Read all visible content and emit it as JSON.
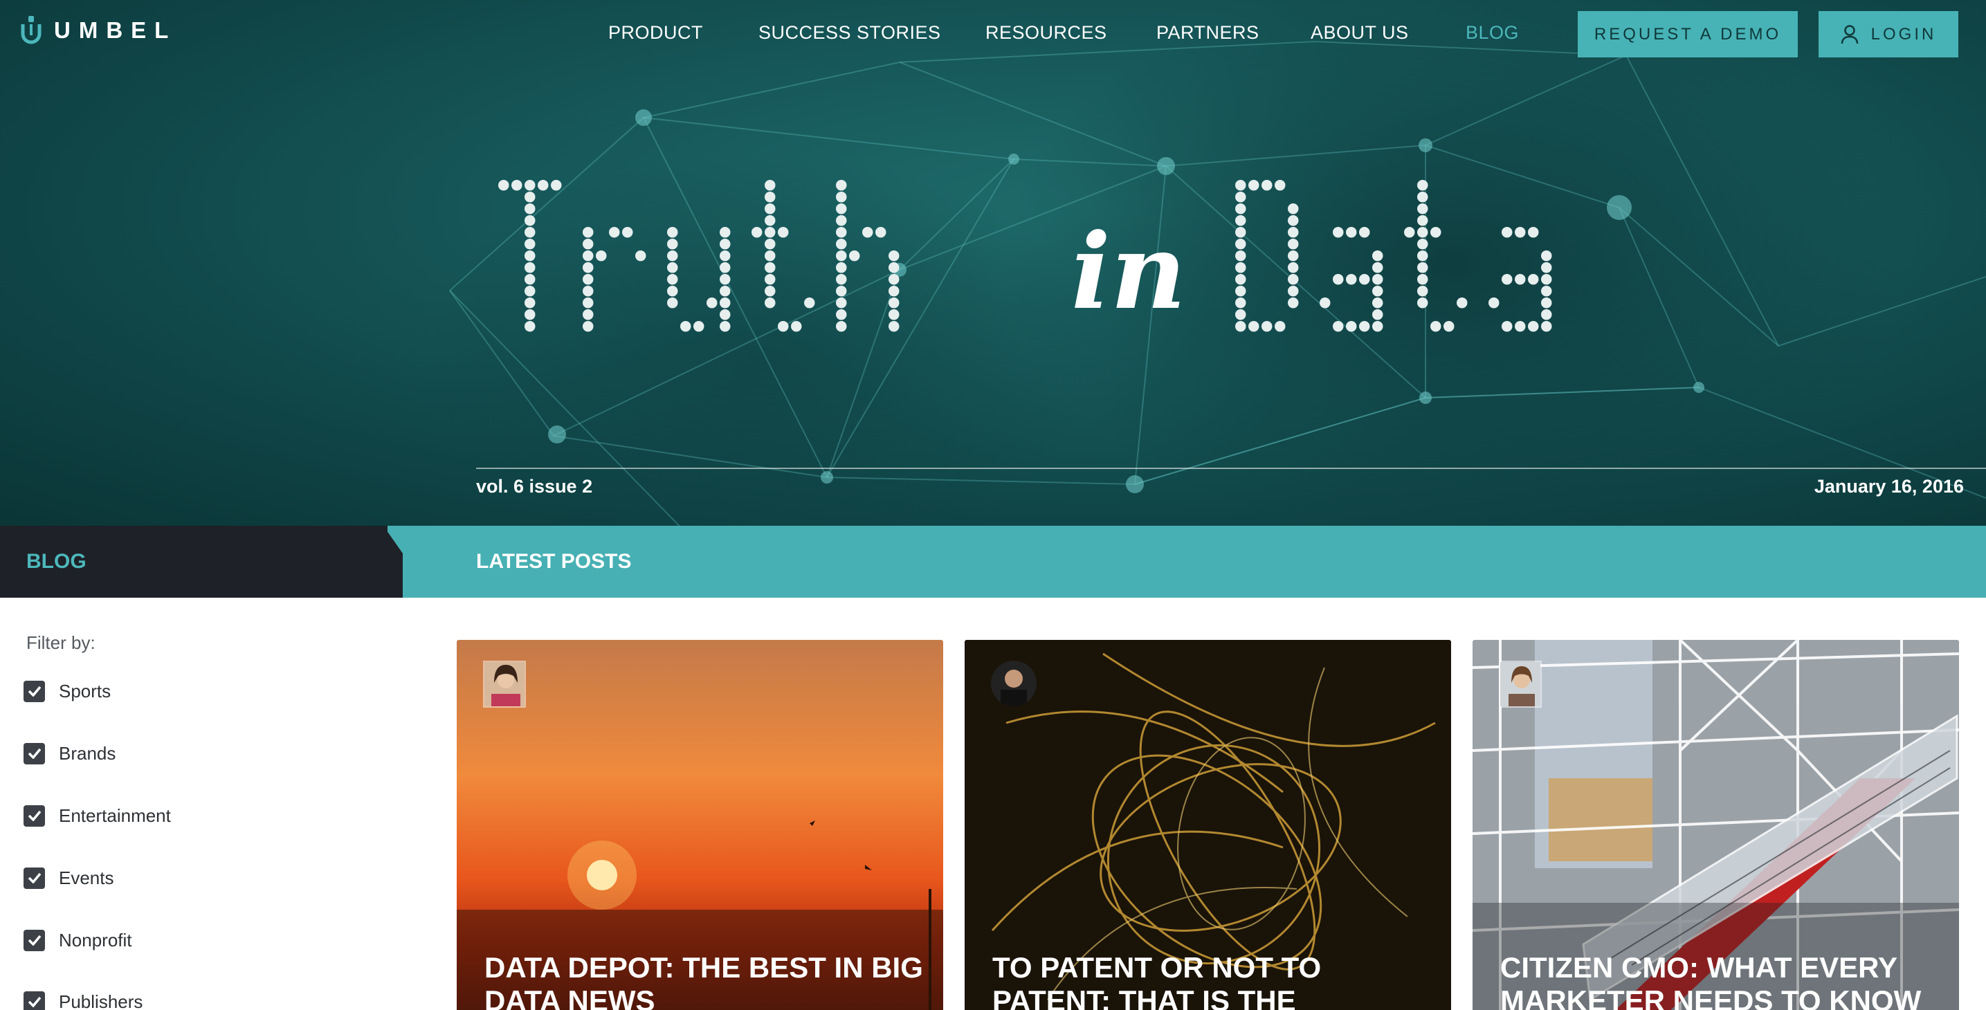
{
  "brand": {
    "name": "UMBEL"
  },
  "nav": {
    "links": [
      "PRODUCT",
      "SUCCESS STORIES",
      "RESOURCES",
      "PARTNERS",
      "ABOUT US",
      "BLOG"
    ],
    "demo_button": "REQUEST A DEMO",
    "login_button": "LOGIN"
  },
  "hero": {
    "title_word1": "Truth",
    "title_word2": "in",
    "title_word3": "Data",
    "issue": "vol. 6 issue 2",
    "date": "January 16, 2016"
  },
  "section": {
    "blog": "BLOG",
    "latest": "LATEST POSTS"
  },
  "filter": {
    "title": "Filter by:",
    "items": [
      {
        "label": "Sports",
        "checked": true
      },
      {
        "label": "Brands",
        "checked": true
      },
      {
        "label": "Entertainment",
        "checked": true
      },
      {
        "label": "Events",
        "checked": true
      },
      {
        "label": "Nonprofit",
        "checked": true
      },
      {
        "label": "Publishers",
        "checked": true
      }
    ]
  },
  "posts": [
    {
      "title": "DATA DEPOT: THE BEST IN BIG DATA NEWS"
    },
    {
      "title": "TO PATENT OR NOT TO PATENT: THAT IS THE"
    },
    {
      "title": "CITIZEN CMO: WHAT EVERY MARKETER NEEDS TO KNOW"
    }
  ],
  "colors": {
    "accent": "#47b3b6",
    "hero_dark": "#0f4446",
    "bar_dark": "#1e2127"
  },
  "icons": {
    "brand_logo": "umbel-logo-icon",
    "login": "user-icon",
    "check": "checkbox-checked-icon"
  }
}
